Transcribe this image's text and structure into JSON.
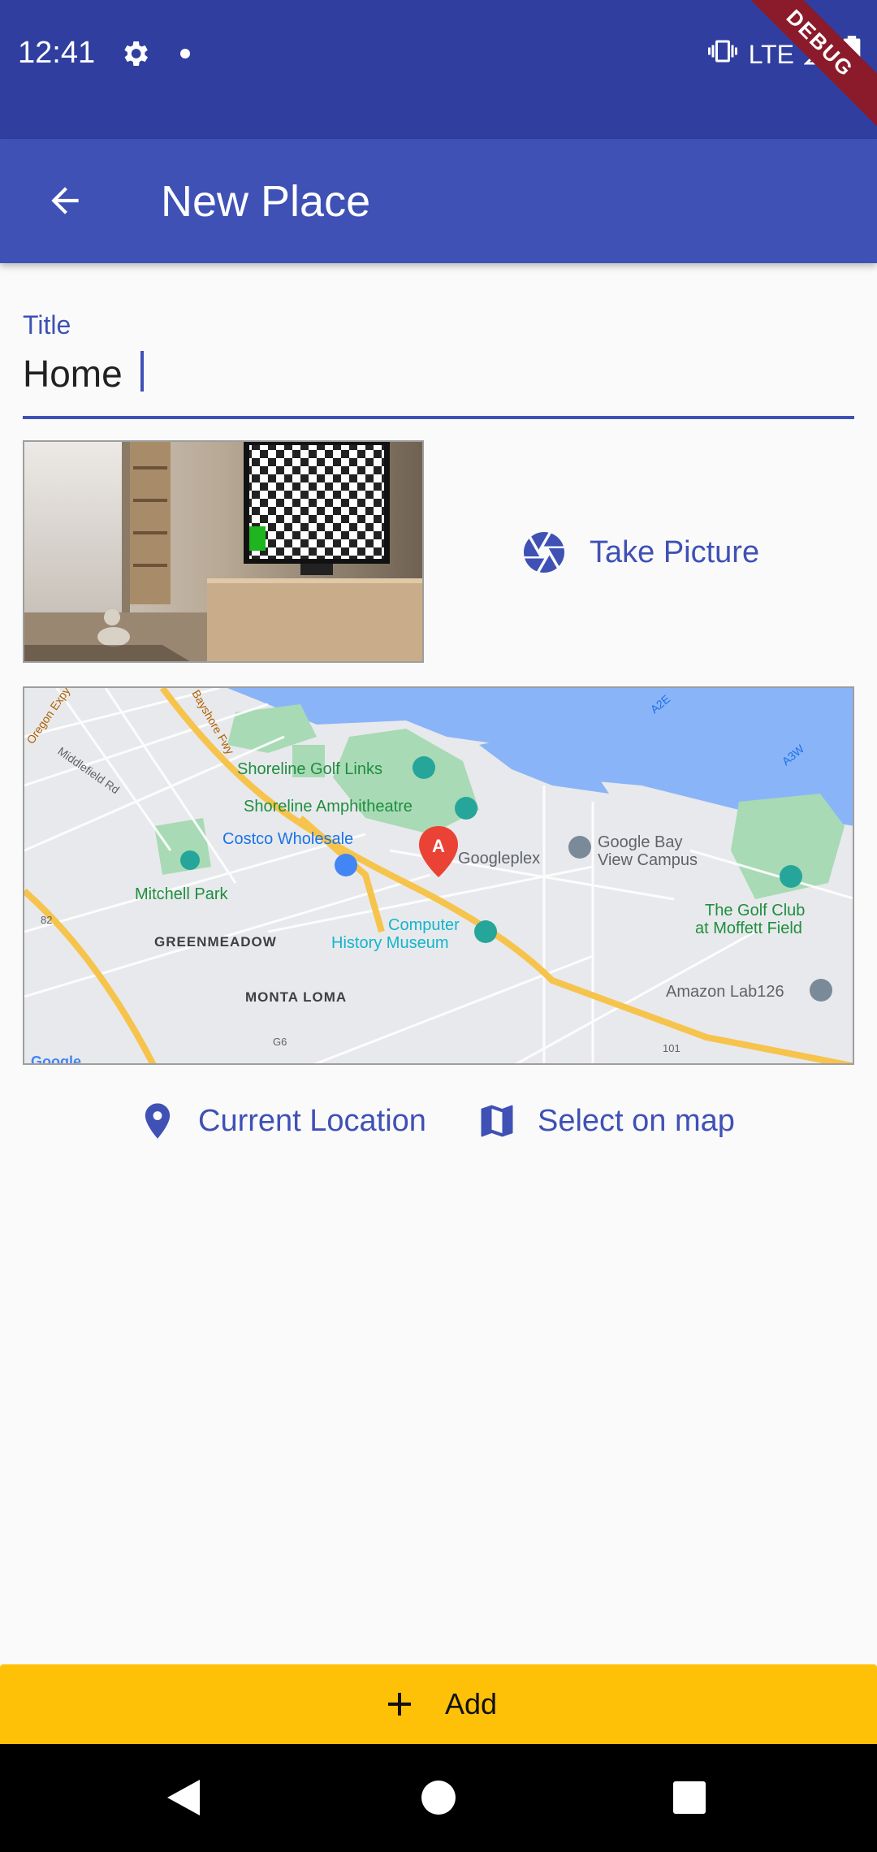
{
  "status_bar": {
    "time": "12:41",
    "network": "LTE",
    "debug_banner": "DEBUG"
  },
  "app_bar": {
    "title": "New Place"
  },
  "form": {
    "title_label": "Title",
    "title_value": "Home"
  },
  "image_preview": {
    "take_picture_label": "Take Picture"
  },
  "map_preview": {
    "labels": {
      "shoreline_golf": "Shoreline Golf Links",
      "shoreline_amphi": "Shoreline Amphitheatre",
      "costco": "Costco Wholesale",
      "googleplex": "Googleplex",
      "google_bay_1": "Google Bay",
      "google_bay_2": "View Campus",
      "mitchell": "Mitchell Park",
      "greenmeadow": "GREENMEADOW",
      "computer_1": "Computer",
      "computer_2": "History Museum",
      "golf_club_1": "The Golf Club",
      "golf_club_2": "at Moffett Field",
      "monta_loma": "MONTA LOMA",
      "amazon": "Amazon Lab126",
      "middlefield": "Middlefield Rd",
      "oregon": "Oregon Expy",
      "bayshore": "Bayshore Fwy",
      "a2e": "A2E",
      "a3w": "A3W",
      "r82": "82",
      "r101": "101",
      "g6": "G6",
      "marker": "A",
      "google": "Google"
    }
  },
  "location_actions": {
    "current_location_label": "Current Location",
    "select_on_map_label": "Select on map"
  },
  "submit": {
    "add_label": "Add"
  },
  "colors": {
    "primary": "#3f51b5",
    "primary_dark": "#303f9f",
    "accent": "#ffc107"
  }
}
